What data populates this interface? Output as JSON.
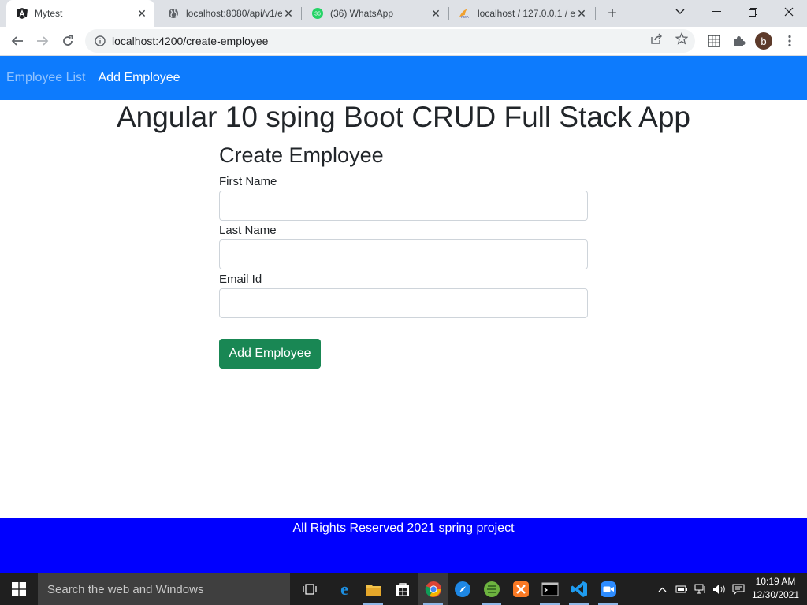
{
  "browser": {
    "tabs": [
      {
        "title": "Mytest",
        "icon": "angular-icon",
        "active": true
      },
      {
        "title": "localhost:8080/api/v1/e",
        "icon": "globe-icon",
        "active": false
      },
      {
        "title": "(36) WhatsApp",
        "icon": "whatsapp-icon",
        "badge": "36",
        "active": false
      },
      {
        "title": "localhost / 127.0.0.1 / e",
        "icon": "phpmyadmin-icon",
        "active": false
      }
    ],
    "url": "localhost:4200/create-employee",
    "profile_initial": "b"
  },
  "navbar": {
    "items": [
      "Employee List",
      "Add Employee"
    ]
  },
  "page": {
    "title": "Angular 10 sping Boot CRUD Full Stack App"
  },
  "form": {
    "heading": "Create Employee",
    "fields": [
      {
        "label": "First Name",
        "value": ""
      },
      {
        "label": "Last Name",
        "value": ""
      },
      {
        "label": "Email Id",
        "value": ""
      }
    ],
    "submit_label": "Add Employee"
  },
  "footer": {
    "text": "All Rights Reserved 2021 spring project"
  },
  "taskbar": {
    "search_placeholder": "Search the web and Windows",
    "time": "10:19 AM",
    "date": "12/30/2021"
  },
  "colors": {
    "navbar": "#0d7bfd",
    "footer": "#0000ff",
    "submit": "#198754"
  }
}
